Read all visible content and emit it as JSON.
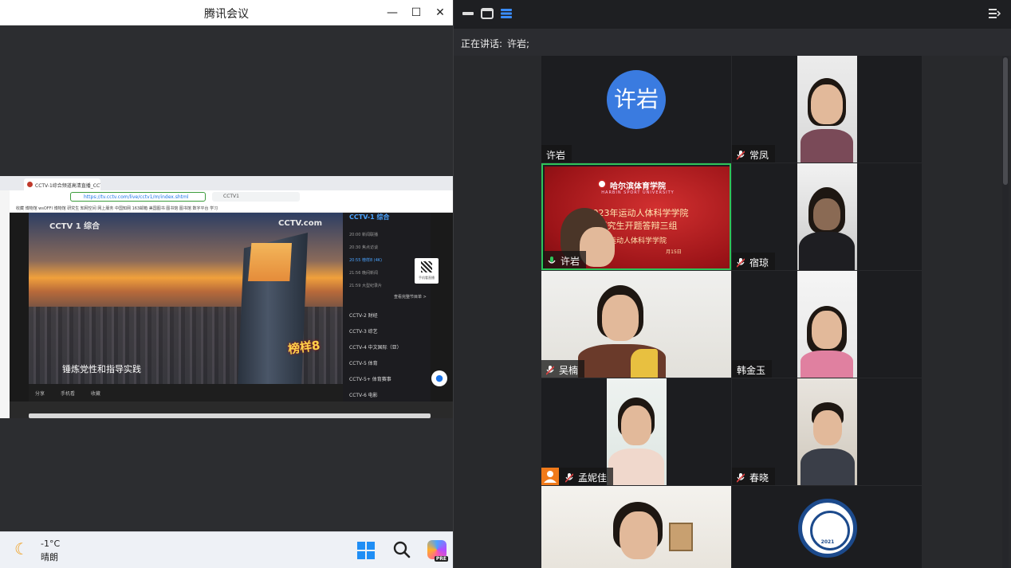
{
  "window": {
    "title": "腾讯会议"
  },
  "browser": {
    "tab_title": "CCTV-1综合频道高清直播_CCTV",
    "url": "https://tv.cctv.com/live/cctv1/m/index.shtml",
    "search": "CCTV1",
    "bookmarks": "收藏  博物馆  wsOFFI  博物馆  研究生  知网空间  网上服务  中国知网  163邮箱  美国图书  图书馆  图书馆  数字平台  学习"
  },
  "player": {
    "logo_left": "CCTV 1 综合",
    "logo_right": "CCTV.com",
    "subtitle": "锤炼党性和指导实践",
    "badge": "榜样8",
    "controls": [
      "分享",
      "手机看",
      "收藏"
    ]
  },
  "channel_list": {
    "header": "CCTV-1 综合",
    "programs": [
      "20:00 新闻联播",
      "20:30 焦点访谈",
      "20:55 榜样8 (4K)",
      "21:56 晚间新闻",
      "21:59 大型纪录片"
    ],
    "more": "查看完整节目单 >",
    "channels": [
      "CCTV-2 财经",
      "CCTV-3 综艺",
      "CCTV-4 中文国际（亚）",
      "CCTV-5 体育",
      "CCTV-5+ 体育赛事",
      "CCTV-6 电影"
    ],
    "qr_label": "手机看直播"
  },
  "taskbar": {
    "temperature": "-1°C",
    "condition": "晴朗",
    "copilot_badge": "PRE"
  },
  "meeting": {
    "speaking_label": "正在讲话:",
    "speaking_name": "许岩;",
    "participants": [
      {
        "name": "许岩",
        "avatar_text": "许岩"
      },
      {
        "name": "常凤"
      },
      {
        "name": "许岩"
      },
      {
        "name": "宿琼"
      },
      {
        "name": "吴楠"
      },
      {
        "name": "韩金玉"
      },
      {
        "name": "孟妮佳"
      },
      {
        "name": "春晓"
      }
    ],
    "banner": {
      "school": "哈尔滨体育学院",
      "school_en": "HARBIN SPORT UNIVERSITY",
      "line1": "2023年运动人体科学学院",
      "line2": "研究生开题答辩三组",
      "line3": "运动人体科学学院",
      "line4": "月15日"
    },
    "emblem_year": "2021"
  }
}
